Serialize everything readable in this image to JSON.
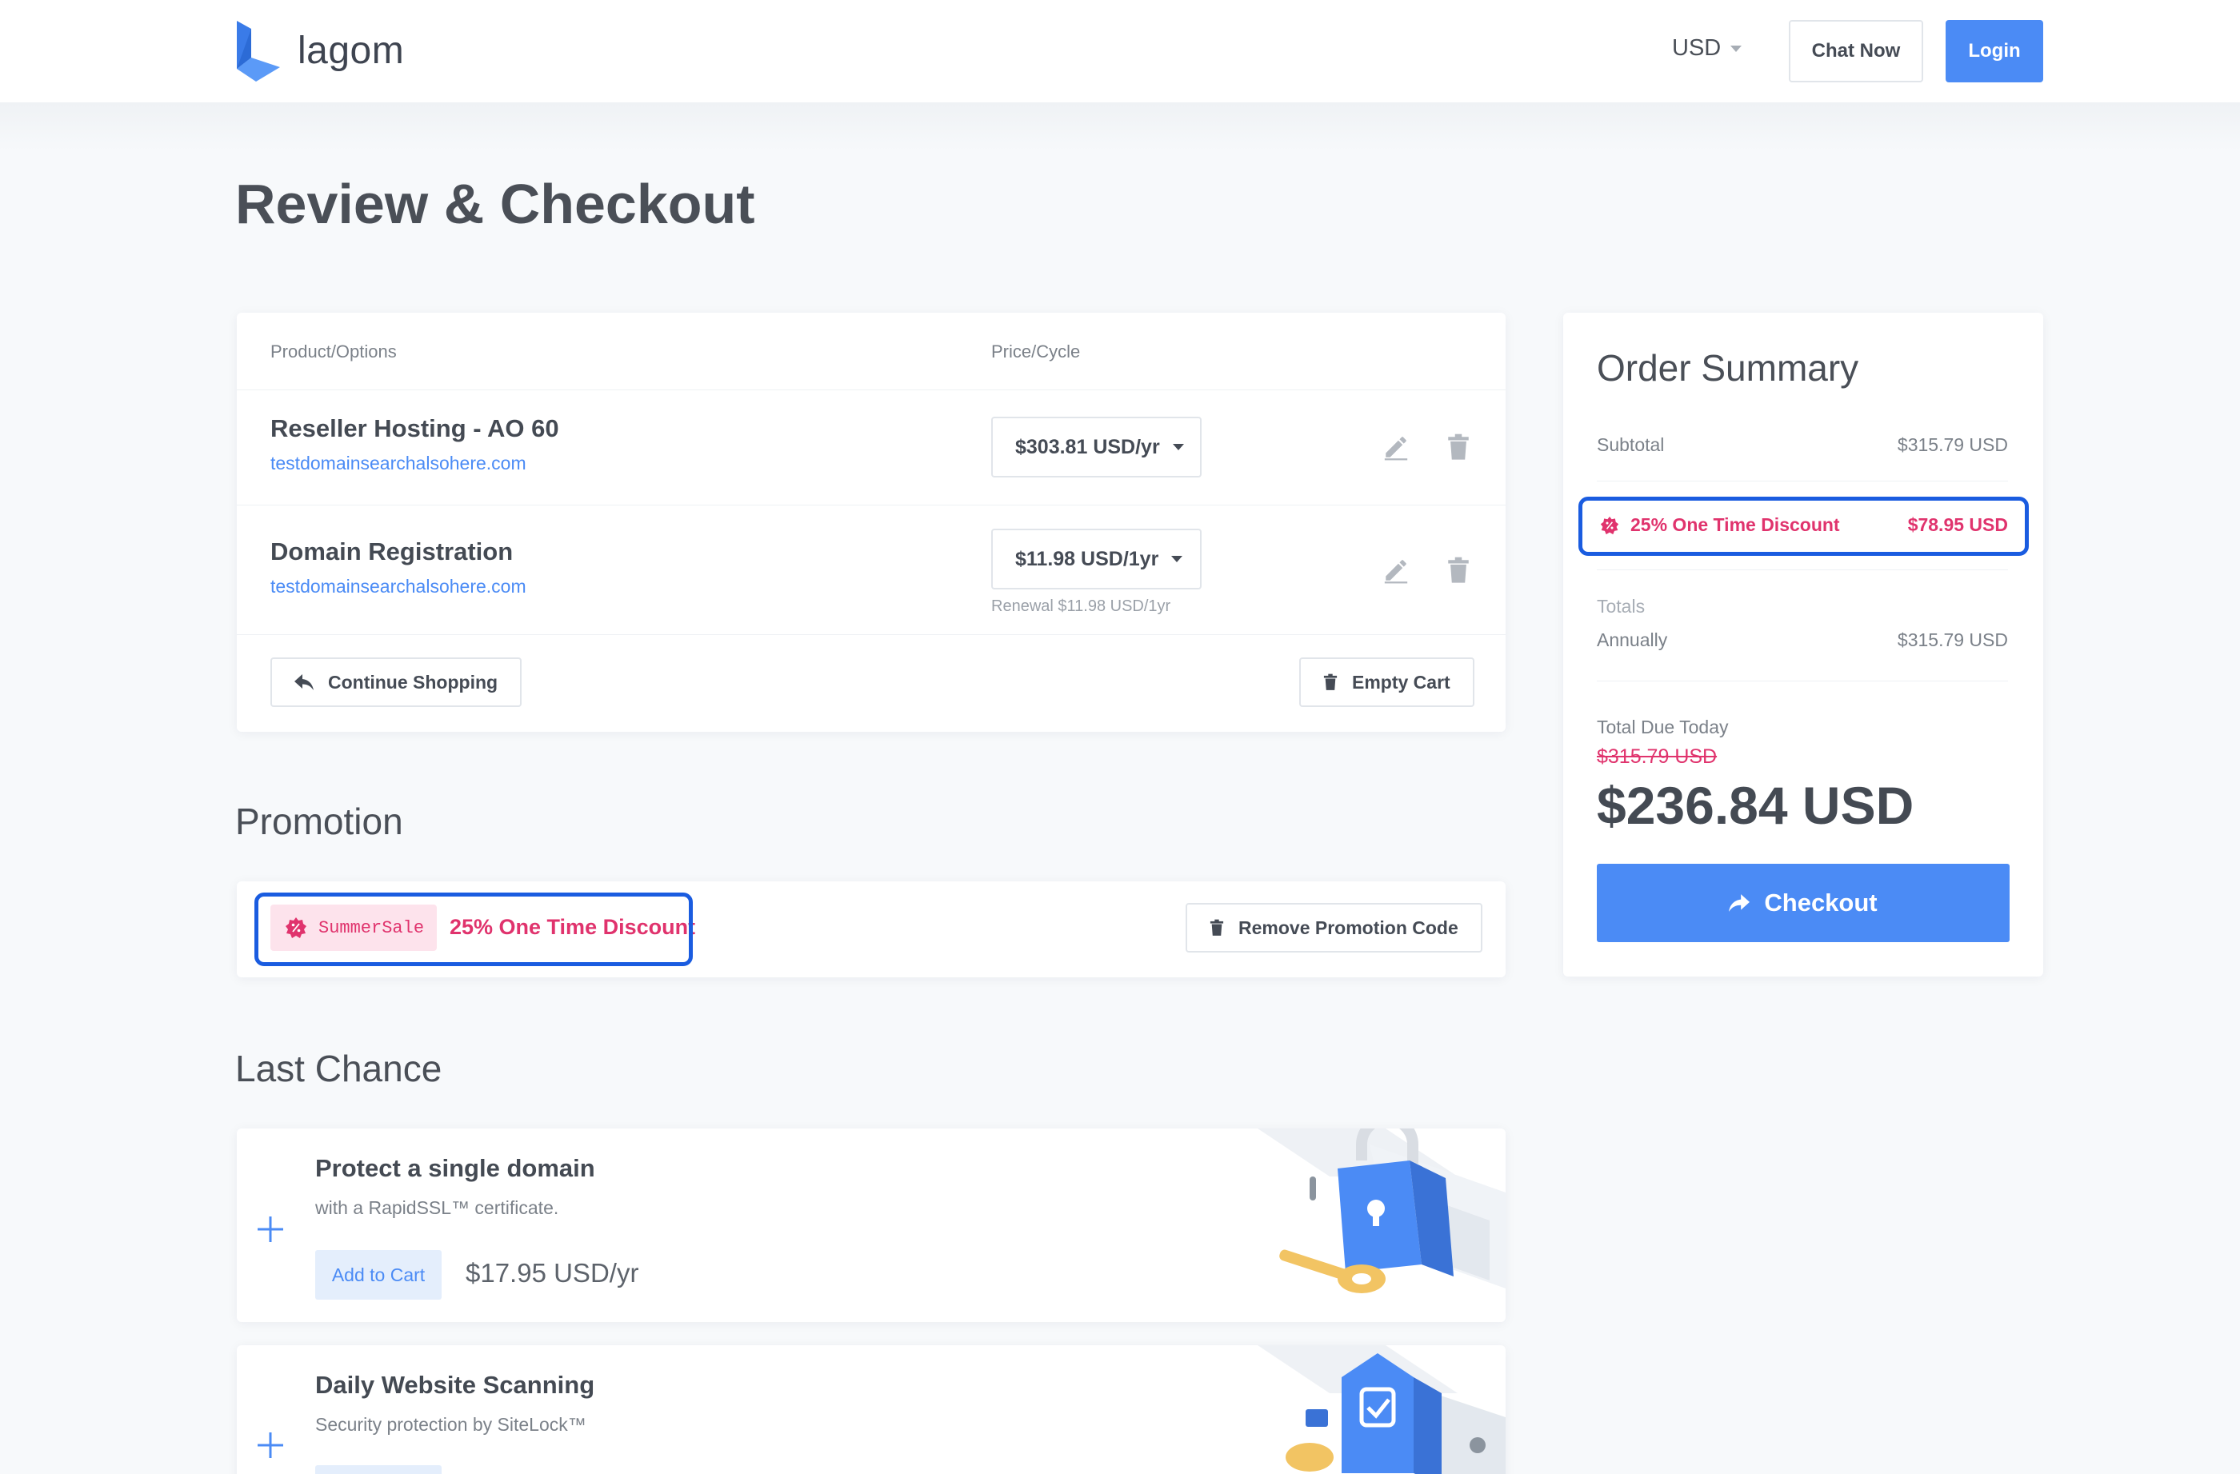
{
  "header": {
    "logo_text": "lagom",
    "currency": "USD",
    "chat_label": "Chat Now",
    "login_label": "Login"
  },
  "page": {
    "title": "Review & Checkout"
  },
  "cart": {
    "col_product": "Product/Options",
    "col_price": "Price/Cycle",
    "items": [
      {
        "name": "Reseller Hosting - AO 60",
        "domain": "testdomainsearchalsohere.com",
        "price": "$303.81 USD/yr",
        "renewal": ""
      },
      {
        "name": "Domain Registration",
        "domain": "testdomainsearchalsohere.com",
        "price": "$11.98 USD/1yr",
        "renewal": "Renewal $11.98 USD/1yr"
      }
    ],
    "continue_label": "Continue Shopping",
    "empty_label": "Empty Cart"
  },
  "promotion": {
    "title": "Promotion",
    "code": "SummerSale",
    "description": "25% One Time Discount",
    "remove_label": "Remove Promotion Code"
  },
  "summary": {
    "title": "Order Summary",
    "subtotal_label": "Subtotal",
    "subtotal_value": "$315.79 USD",
    "discount_label": "25% One Time Discount",
    "discount_value": "$78.95 USD",
    "totals_label": "Totals",
    "annually_label": "Annually",
    "annually_value": "$315.79 USD",
    "due_label": "Total Due Today",
    "old_total": "$315.79 USD",
    "total": "$236.84 USD",
    "checkout_label": "Checkout"
  },
  "last_chance": {
    "title": "Last Chance",
    "offers": [
      {
        "title": "Protect a single domain",
        "subtitle": "with a RapidSSL™ certificate.",
        "add_label": "Add to Cart",
        "price": "$17.95 USD/yr"
      },
      {
        "title": "Daily Website Scanning",
        "subtitle": "Security protection by SiteLock™",
        "add_label": "",
        "price": ""
      }
    ]
  },
  "colors": {
    "accent": "#4b8bf5",
    "discount": "#e0336d",
    "highlight": "#1a5ce0"
  }
}
